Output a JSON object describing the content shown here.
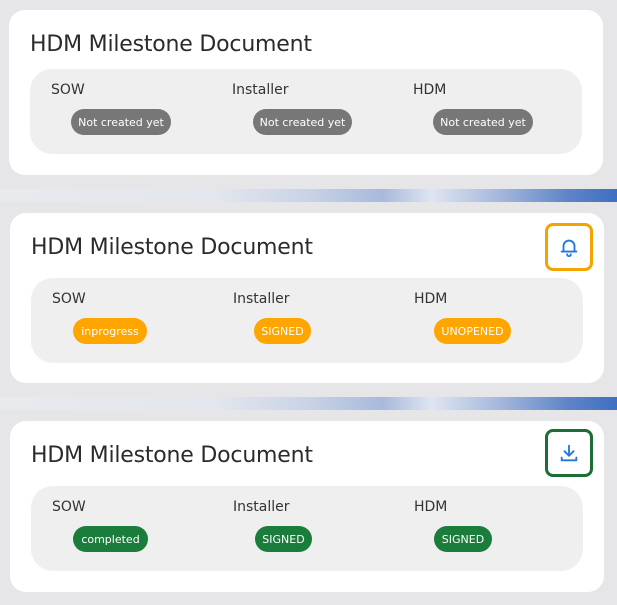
{
  "cards": [
    {
      "title": "HDM Milestone Document",
      "columns": [
        {
          "label": "SOW",
          "status": "Not created yet"
        },
        {
          "label": "Installer",
          "status": "Not created yet"
        },
        {
          "label": "HDM",
          "status": "Not created yet"
        }
      ]
    },
    {
      "title": "HDM Milestone Document",
      "action_icon": "bell-icon",
      "action_color": "#f5a300",
      "columns": [
        {
          "label": "SOW",
          "status": "inprogress"
        },
        {
          "label": "Installer",
          "status": "SIGNED"
        },
        {
          "label": "HDM",
          "status": "UNOPENED"
        }
      ]
    },
    {
      "title": "HDM Milestone Document",
      "action_icon": "download-icon",
      "action_color": "#1b6e34",
      "columns": [
        {
          "label": "SOW",
          "status": "completed"
        },
        {
          "label": "Installer",
          "status": "SIGNED"
        },
        {
          "label": "HDM",
          "status": "SIGNED"
        }
      ]
    }
  ],
  "colors": {
    "status_gray": "#777777",
    "status_orange": "#ffa500",
    "status_green": "#1b7d3b",
    "icon_blue": "#1e78e0"
  }
}
